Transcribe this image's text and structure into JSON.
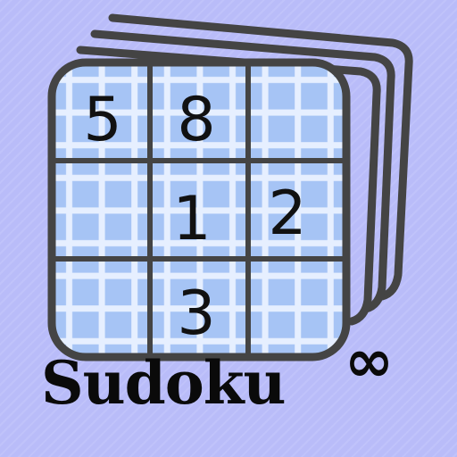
{
  "app": {
    "title": "Sudoku",
    "title_symbol": "∞"
  },
  "board": {
    "cells": [
      {
        "row": 0,
        "col": 0,
        "value": "5"
      },
      {
        "row": 0,
        "col": 1,
        "value": "8"
      },
      {
        "row": 1,
        "col": 1,
        "value": "1"
      },
      {
        "row": 1,
        "col": 2,
        "value": "2"
      },
      {
        "row": 2,
        "col": 1,
        "value": "3"
      }
    ]
  },
  "colors": {
    "background": "#b9bcf9",
    "board_fill": "#a6c4f5",
    "board_frame": "#444444",
    "stack_stroke": "#444444",
    "digits": "#111111"
  },
  "icons": {
    "stack": "stacked-pages-icon",
    "infinity": "infinity-icon"
  }
}
